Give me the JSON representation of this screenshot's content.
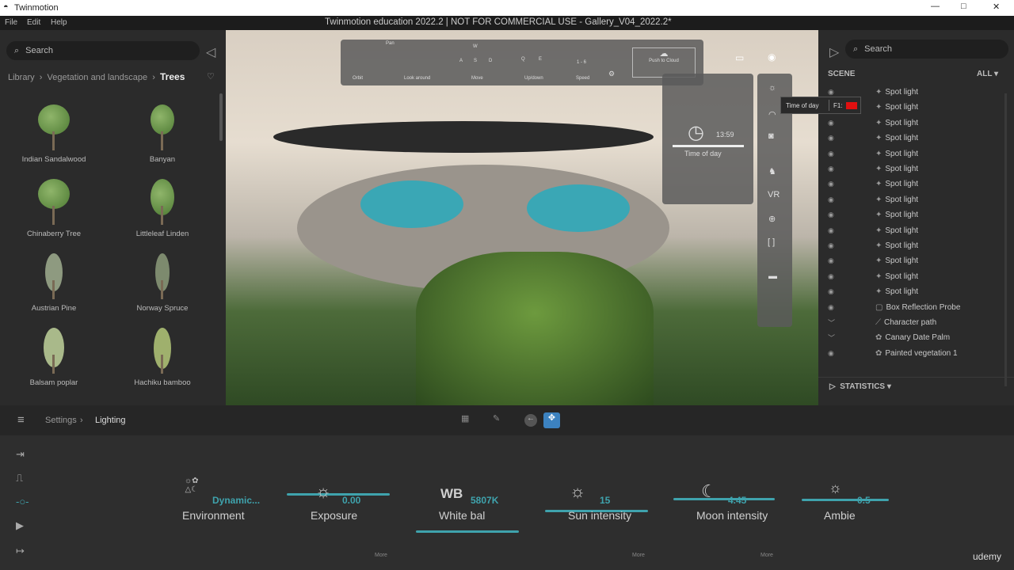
{
  "window": {
    "app_title": "Twinmotion",
    "doc_title": "Twinmotion education 2022.2 | NOT FOR COMMERCIAL USE - Gallery_V04_2022.2*",
    "menu": [
      "File",
      "Edit",
      "Help"
    ]
  },
  "library": {
    "search_placeholder": "Search",
    "breadcrumb": [
      "Library",
      "Vegetation and landscape",
      "Trees"
    ],
    "items": [
      "Indian Sandalwood",
      "Banyan",
      "Chinaberry Tree",
      "Littleleaf Linden",
      "Austrian Pine",
      "Norway Spruce",
      "Balsam poplar",
      "Hachiku bamboo"
    ]
  },
  "nav_help": {
    "pan": "Pan",
    "orbit": "Orbit",
    "look_around": "Look around",
    "move": "Move",
    "updown": "Up/down",
    "speed": "Speed",
    "speed_value": "1 - 6",
    "keys_move": [
      "W",
      "A",
      "S",
      "D"
    ],
    "keys_updown": [
      "Q",
      "E"
    ],
    "push_to_cloud": "Push to Cloud"
  },
  "time_of_day": {
    "time": "13:59",
    "label": "Time of day",
    "tooltip": "Time of day",
    "shortcut": "F1:",
    "vr": "VR"
  },
  "scene": {
    "search_placeholder": "Search",
    "title": "SCENE",
    "filter": "ALL",
    "items": [
      "Spot light",
      "Spot light",
      "Spot light",
      "Spot light",
      "Spot light",
      "Spot light",
      "Spot light",
      "Spot light",
      "Spot light",
      "Spot light",
      "Spot light",
      "Spot light",
      "Spot light",
      "Spot light",
      "Box Reflection Probe",
      "Character path",
      "Canary Date Palm",
      "Painted vegetation 1"
    ],
    "statistics": "STATISTICS"
  },
  "bottombar": {
    "breadcrumb": [
      "Settings",
      "Lighting"
    ]
  },
  "lighting": {
    "environment": {
      "label": "Environment",
      "value": "Dynamic..."
    },
    "exposure": {
      "label": "Exposure",
      "value": "0.00"
    },
    "white_balance": {
      "label": "White bal",
      "icon_text": "WB",
      "value": "5807K"
    },
    "sun": {
      "label": "Sun intensity",
      "value": "15"
    },
    "moon": {
      "label": "Moon intensity",
      "value": "4.45"
    },
    "ambient": {
      "label": "Ambie",
      "value": "0.5"
    },
    "more": "More"
  },
  "accent": "#3fa3ad",
  "watermark": "udemy"
}
